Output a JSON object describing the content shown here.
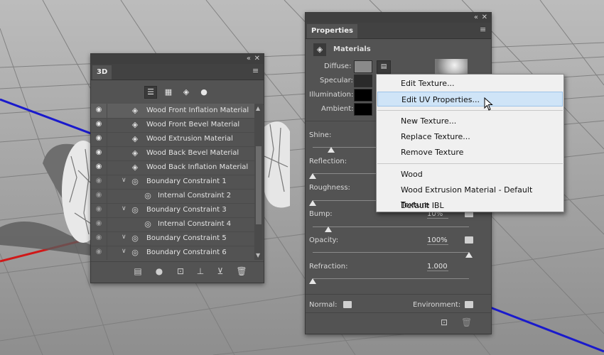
{
  "panel3d": {
    "title": "3D",
    "filters": [
      "scene-filter-icon",
      "mesh-filter-icon",
      "material-filter-icon",
      "light-filter-icon"
    ],
    "layers": [
      {
        "label": "Wood Front Inflation Material",
        "type": "material",
        "visible": true,
        "selected": true
      },
      {
        "label": "Wood Front Bevel Material",
        "type": "material",
        "visible": true
      },
      {
        "label": "Wood Extrusion Material",
        "type": "material",
        "visible": true
      },
      {
        "label": "Wood Back Bevel Material",
        "type": "material",
        "visible": true
      },
      {
        "label": "Wood Back Inflation Material",
        "type": "material",
        "visible": true
      },
      {
        "label": "Boundary Constraint 1",
        "type": "constraint",
        "visible": true
      },
      {
        "label": "Internal Constraint 2",
        "type": "internal",
        "visible": true
      },
      {
        "label": "Boundary Constraint 3",
        "type": "constraint",
        "visible": true
      },
      {
        "label": "Internal Constraint 4",
        "type": "internal",
        "visible": true
      },
      {
        "label": "Boundary Constraint 5",
        "type": "constraint",
        "visible": true
      },
      {
        "label": "Boundary Constraint 6",
        "type": "constraint",
        "visible": true
      }
    ]
  },
  "properties": {
    "title": "Properties",
    "section": "Materials",
    "labels": {
      "diffuse": "Diffuse:",
      "specular": "Specular:",
      "illumination": "Illumination:",
      "ambient": "Ambient:",
      "shine": "Shine:",
      "reflection": "Reflection:",
      "roughness": "Roughness:",
      "bump": "Bump:",
      "opacity": "Opacity:",
      "refraction": "Refraction:",
      "normal": "Normal:",
      "environment": "Environment:"
    },
    "values": {
      "bump": "10%",
      "opacity": "100%",
      "refraction": "1.000"
    },
    "slider_levels": {
      "shine": 0.12,
      "reflection": 0.0,
      "roughness": 0.0,
      "bump": 0.1,
      "opacity": 1.0,
      "refraction": 0.0
    },
    "colors": {
      "diffuse": "#8a8a8a",
      "specular": "#2a2a2a",
      "illumination": "#000000",
      "ambient": "#000000"
    }
  },
  "dropdown": {
    "items": [
      {
        "label": "Edit Texture...",
        "highlighted": false
      },
      {
        "label": "Edit UV Properties...",
        "highlighted": true
      },
      {
        "separator": true
      },
      {
        "label": "New Texture...",
        "highlighted": false
      },
      {
        "label": "Replace Texture...",
        "highlighted": false
      },
      {
        "label": "Remove Texture",
        "highlighted": false
      },
      {
        "separator": true
      },
      {
        "label": "Wood",
        "highlighted": false
      },
      {
        "label": "Wood Extrusion Material - Default Texture",
        "highlighted": false
      },
      {
        "label": "Default IBL",
        "highlighted": false
      }
    ]
  }
}
